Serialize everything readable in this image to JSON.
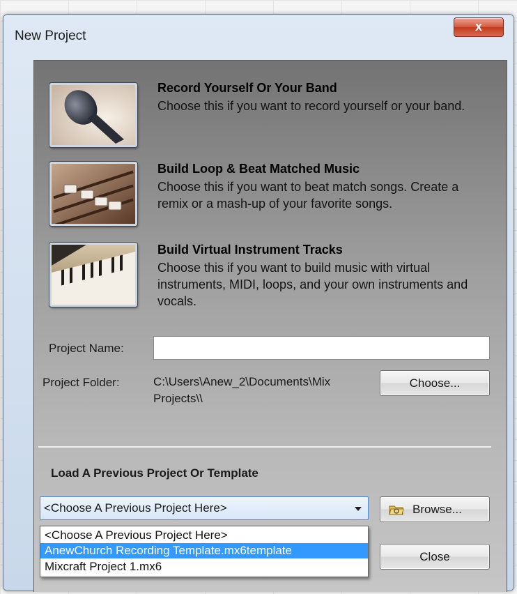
{
  "window": {
    "title": "New Project",
    "close_label": "x"
  },
  "options": [
    {
      "title": "Record Yourself Or Your Band",
      "description": "Choose this if you want to record yourself or your band."
    },
    {
      "title": "Build Loop & Beat Matched Music",
      "description": "Choose this if you want to beat match songs. Create a remix or a mash-up of your favorite songs."
    },
    {
      "title": "Build Virtual Instrument Tracks",
      "description": "Choose this if you want to build music with virtual instruments, MIDI, loops, and your own instruments and vocals."
    }
  ],
  "project": {
    "name_label": "Project Name:",
    "name_value": "",
    "folder_label": "Project Folder:",
    "folder_path": "C:\\Users\\Anew_2\\Documents\\Mix Projects\\\\",
    "choose_label": "Choose..."
  },
  "load": {
    "heading": "Load A Previous Project Or Template",
    "selected": "<Choose A Previous Project Here>",
    "options": [
      "<Choose A Previous Project Here>",
      "AnewChurch Recording Template.mx6template",
      "Mixcraft Project 1.mx6"
    ],
    "browse_label": "Browse...",
    "close_label": "Close"
  },
  "icons": {
    "option_1": "microphone-icon",
    "option_2": "mixer-faders-icon",
    "option_3": "keyboard-icon",
    "browse": "folder-icon"
  }
}
